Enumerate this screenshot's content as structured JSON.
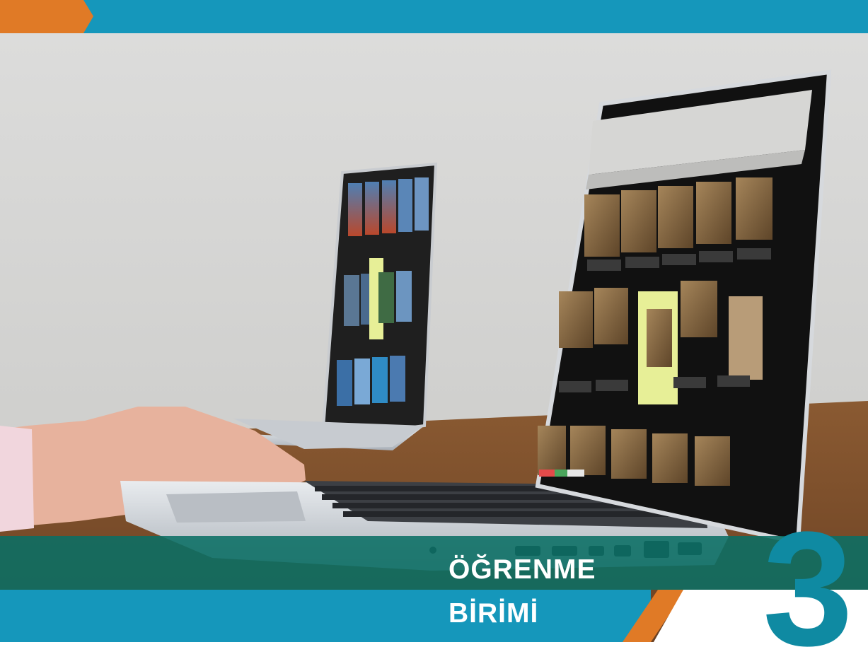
{
  "banner": {
    "title_line_1": "ÖĞRENME",
    "title_line_2": "BİRİMİ",
    "unit_number": "3"
  },
  "colors": {
    "banner_blue": "#1597bb",
    "accent_orange": "#e07a26",
    "overlay_teal": "#0a6e64",
    "number_teal": "#0f8aa2"
  },
  "photo": {
    "subject": "two-laptops-photo-gallery-app"
  }
}
